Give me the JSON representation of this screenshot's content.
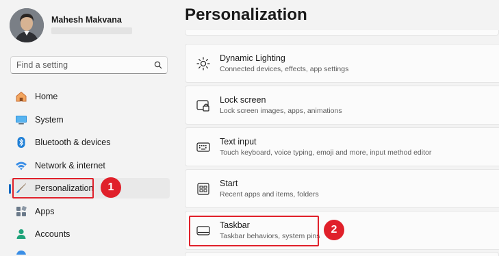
{
  "user": {
    "name": "Mahesh Makvana",
    "email": "••••••••••••••••••"
  },
  "search": {
    "placeholder": "Find a setting"
  },
  "nav": {
    "items": [
      {
        "label": "Home",
        "icon": "home-icon"
      },
      {
        "label": "System",
        "icon": "system-icon"
      },
      {
        "label": "Bluetooth & devices",
        "icon": "bluetooth-icon"
      },
      {
        "label": "Network & internet",
        "icon": "wifi-icon"
      },
      {
        "label": "Personalization",
        "icon": "brush-icon",
        "active": true
      },
      {
        "label": "Apps",
        "icon": "apps-icon"
      },
      {
        "label": "Accounts",
        "icon": "accounts-icon"
      }
    ]
  },
  "main": {
    "title": "Personalization",
    "cards": [
      {
        "title": "Dynamic Lighting",
        "subtitle": "Connected devices, effects, app settings",
        "icon": "dynamic-lighting-icon"
      },
      {
        "title": "Lock screen",
        "subtitle": "Lock screen images, apps, animations",
        "icon": "lock-screen-icon"
      },
      {
        "title": "Text input",
        "subtitle": "Touch keyboard, voice typing, emoji and more, input method editor",
        "icon": "keyboard-icon"
      },
      {
        "title": "Start",
        "subtitle": "Recent apps and items, folders",
        "icon": "start-icon"
      },
      {
        "title": "Taskbar",
        "subtitle": "Taskbar behaviors, system pins",
        "icon": "taskbar-icon"
      }
    ]
  },
  "annotations": {
    "step1": "1",
    "step2": "2",
    "color": "#e0202a"
  },
  "colors": {
    "accent": "#0067c0",
    "background": "#f3f3f3"
  }
}
